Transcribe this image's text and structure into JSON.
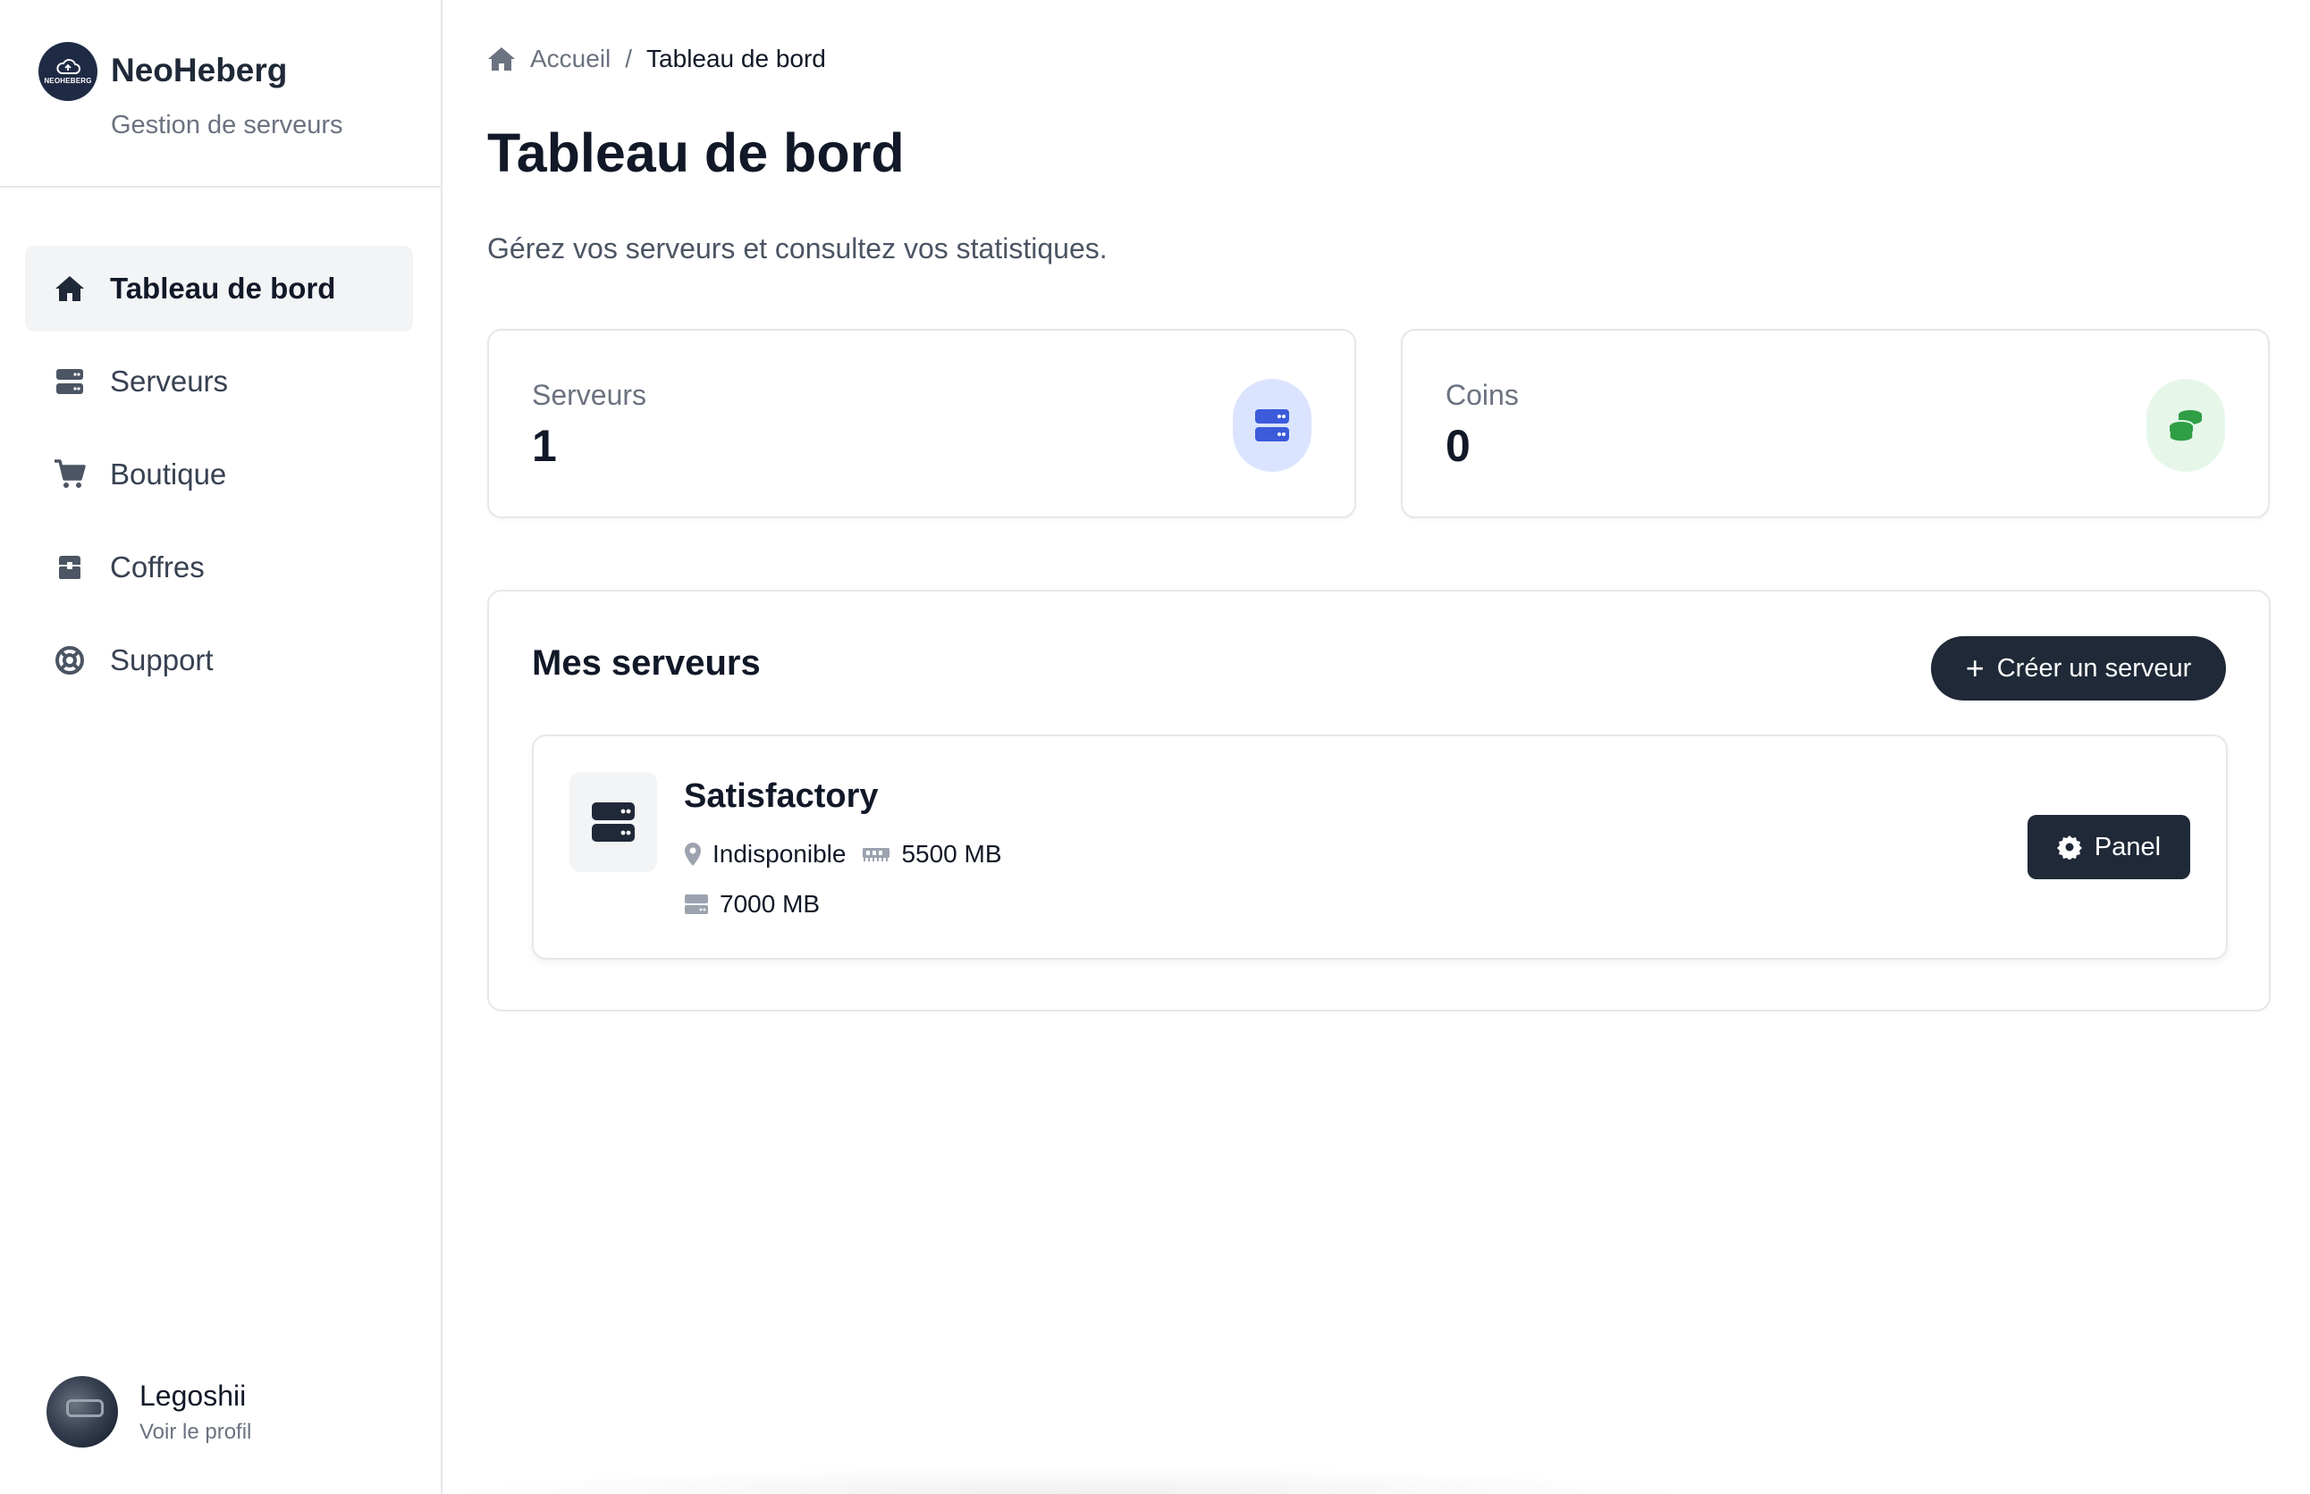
{
  "brand": {
    "name": "NeoHeberg",
    "subtitle": "Gestion de serveurs",
    "logo_text": "NEOHEBERG"
  },
  "sidebar": {
    "items": [
      {
        "label": "Tableau de bord",
        "icon": "home-icon",
        "active": true
      },
      {
        "label": "Serveurs",
        "icon": "server-icon"
      },
      {
        "label": "Boutique",
        "icon": "cart-icon"
      },
      {
        "label": "Coffres",
        "icon": "chest-icon"
      },
      {
        "label": "Support",
        "icon": "lifebuoy-icon"
      }
    ]
  },
  "user": {
    "name": "Legoshii",
    "profile_link": "Voir le profil"
  },
  "breadcrumb": {
    "home": "Accueil",
    "separator": "/",
    "current": "Tableau de bord"
  },
  "page": {
    "title": "Tableau de bord",
    "description": "Gérez vos serveurs et consultez vos statistiques."
  },
  "stats": [
    {
      "label": "Serveurs",
      "value": "1",
      "icon": "server-icon",
      "color": "#3b5bdb",
      "bg": "#dbe4ff"
    },
    {
      "label": "Coins",
      "value": "0",
      "icon": "coins-icon",
      "color": "#2f9e44",
      "bg": "#e6f7ea"
    }
  ],
  "servers_panel": {
    "title": "Mes serveurs",
    "create_label": "Créer un serveur",
    "servers": [
      {
        "name": "Satisfactory",
        "location": "Indisponible",
        "ram": "5500 MB",
        "disk": "7000 MB",
        "action_label": "Panel"
      }
    ]
  }
}
